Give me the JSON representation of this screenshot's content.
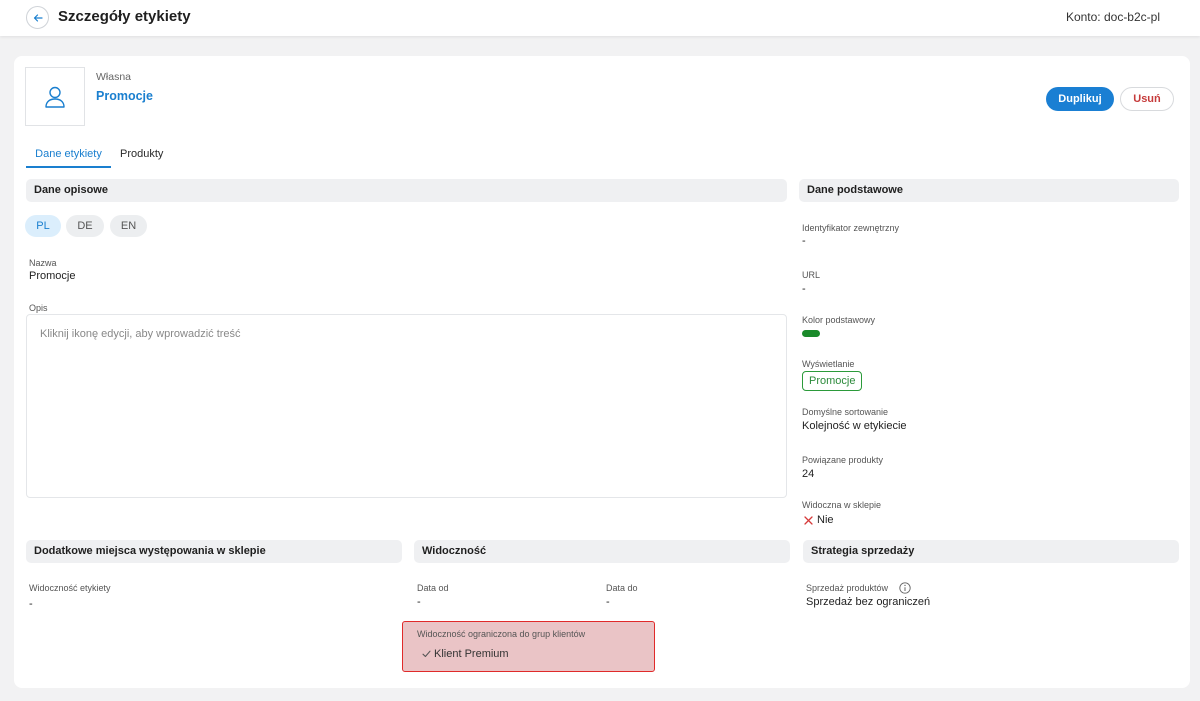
{
  "header": {
    "title": "Szczegóły etykiety",
    "account": "Konto: doc-b2c-pl"
  },
  "entity": {
    "owner": "Własna",
    "name": "Promocje"
  },
  "actions": {
    "duplicate": "Duplikuj",
    "delete": "Usuń"
  },
  "tabs": [
    {
      "label": "Dane etykiety",
      "active": true
    },
    {
      "label": "Produkty",
      "active": false
    }
  ],
  "descriptive": {
    "section_title": "Dane opisowe",
    "languages": [
      "PL",
      "DE",
      "EN"
    ],
    "name_label": "Nazwa",
    "name_value": "Promocje",
    "description_label": "Opis",
    "description_placeholder": "Kliknij ikonę edycji, aby wprowadzić treść"
  },
  "basic": {
    "section_title": "Dane podstawowe",
    "external_id_label": "Identyfikator zewnętrzny",
    "external_id_value": "-",
    "url_label": "URL",
    "url_value": "-",
    "color_label": "Kolor podstawowy",
    "color_value": "#1a8a2a",
    "display_label": "Wyświetlanie",
    "display_value": "Promocje",
    "sorting_label": "Domyślne sortowanie",
    "sorting_value": "Kolejność w etykiecie",
    "related_label": "Powiązane produkty",
    "related_value": "24",
    "visible_label": "Widoczna w sklepie",
    "visible_value": "Nie"
  },
  "additional": {
    "section_title": "Dodatkowe miejsca występowania w sklepie",
    "visibility_label": "Widoczność etykiety",
    "visibility_value": "-"
  },
  "visibility": {
    "section_title": "Widoczność",
    "date_from_label": "Data od",
    "date_from_value": "-",
    "date_to_label": "Data do",
    "date_to_value": "-",
    "groups_label": "Widoczność ograniczona do grup klientów",
    "groups_value": "Klient Premium"
  },
  "sales": {
    "section_title": "Strategia sprzedaży",
    "products_label": "Sprzedaż produktów",
    "products_value": "Sprzedaż bez ograniczeń"
  }
}
